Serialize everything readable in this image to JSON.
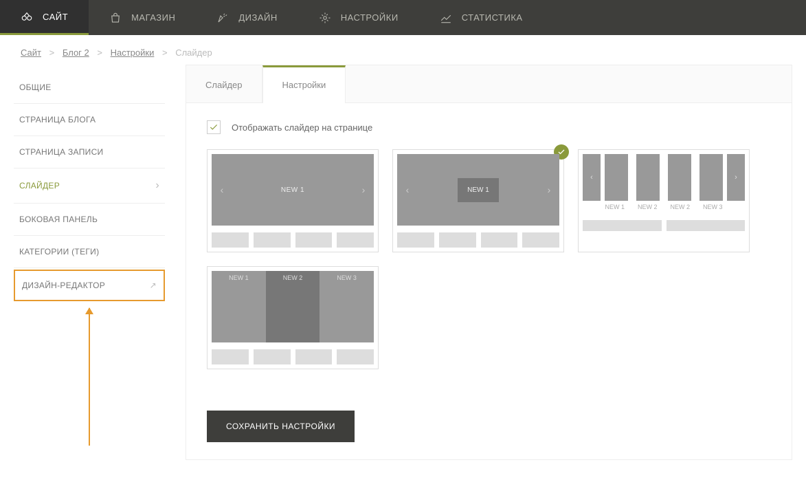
{
  "topnav": [
    {
      "label": "САЙТ",
      "icon": "site",
      "active": true
    },
    {
      "label": "МАГАЗИН",
      "icon": "shop",
      "active": false
    },
    {
      "label": "ДИЗАЙН",
      "icon": "design",
      "active": false
    },
    {
      "label": "НАСТРОЙКИ",
      "icon": "settings",
      "active": false
    },
    {
      "label": "СТАТИСТИКА",
      "icon": "stats",
      "active": false
    }
  ],
  "breadcrumb": {
    "items": [
      "Сайт",
      "Блог 2",
      "Настройки"
    ],
    "current": "Слайдер"
  },
  "sidebar": [
    {
      "label": "ОБЩИЕ",
      "active": false
    },
    {
      "label": "СТРАНИЦА БЛОГА",
      "active": false
    },
    {
      "label": "СТРАНИЦА ЗАПИСИ",
      "active": false
    },
    {
      "label": "СЛАЙДЕР",
      "active": true,
      "chevron": true
    },
    {
      "label": "БОКОВАЯ ПАНЕЛЬ",
      "active": false
    },
    {
      "label": "КАТЕГОРИИ (ТЕГИ)",
      "active": false
    },
    {
      "label": "ДИЗАЙН-РЕДАКТОР",
      "active": false,
      "boxed": true,
      "external": true
    }
  ],
  "tabs": [
    {
      "label": "Слайдер",
      "active": false
    },
    {
      "label": "Настройки",
      "active": true
    }
  ],
  "checkbox_label": "Отображать слайдер на странице",
  "checkbox_checked": true,
  "layouts": {
    "l1": {
      "label": "NEW 1",
      "selected": false
    },
    "l2": {
      "label": "NEW 1",
      "selected": true
    },
    "l3": {
      "labels": [
        "NEW 1",
        "NEW 2",
        "NEW 2",
        "NEW 3"
      ],
      "selected": false
    },
    "l4": {
      "labels": [
        "NEW 1",
        "NEW 2",
        "NEW 3"
      ],
      "selected": false
    }
  },
  "save_button": "СОХРАНИТЬ НАСТРОЙКИ"
}
